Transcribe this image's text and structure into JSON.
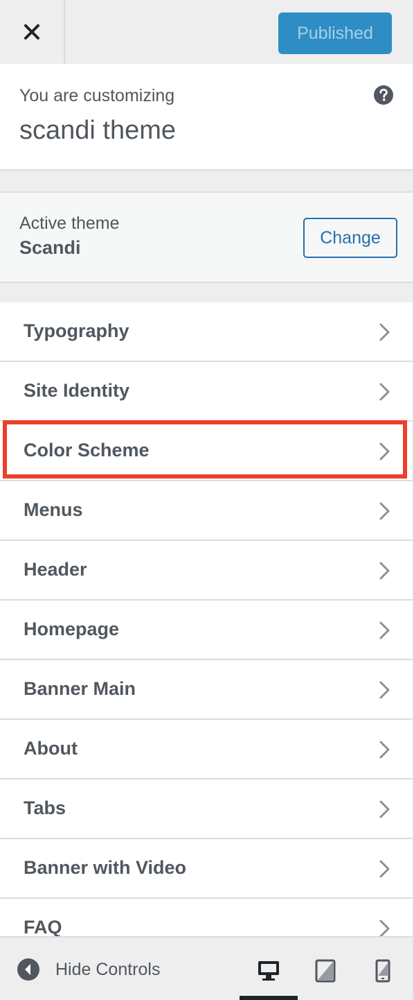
{
  "header": {
    "close_icon": "close-icon",
    "publish_label": "Published"
  },
  "info": {
    "label": "You are customizing",
    "theme_title": "scandi theme",
    "help_icon": "help-icon"
  },
  "active_theme": {
    "label": "Active theme",
    "name": "Scandi",
    "change_label": "Change"
  },
  "sections": [
    {
      "label": "Typography"
    },
    {
      "label": "Site Identity"
    },
    {
      "label": "Color Scheme",
      "highlighted": true
    },
    {
      "label": "Menus"
    },
    {
      "label": "Header"
    },
    {
      "label": "Homepage"
    },
    {
      "label": "Banner Main"
    },
    {
      "label": "About"
    },
    {
      "label": "Tabs"
    },
    {
      "label": "Banner with Video"
    },
    {
      "label": "FAQ"
    }
  ],
  "footer": {
    "hide_controls_label": "Hide Controls",
    "devices": [
      "desktop",
      "tablet",
      "mobile"
    ],
    "active_device": "desktop"
  },
  "colors": {
    "primary": "#2271b1",
    "publish_bg": "#2f8dc5",
    "highlight": "#ec3f2a"
  }
}
